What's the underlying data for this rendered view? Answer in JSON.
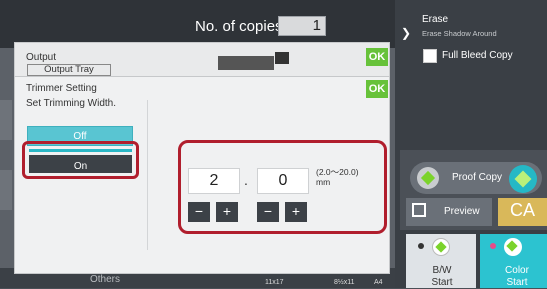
{
  "topbar": {
    "copies_label": "No. of copies",
    "copies_value": "1"
  },
  "right_panel": {
    "erase_title": "Erase",
    "erase_sub": "Erase Shadow Around",
    "full_bleed_label": "Full Bleed Copy",
    "proof_copy_label": "Proof Copy",
    "preview_label": "Preview",
    "ca_label": "CA",
    "bw_label": "B/W\nStart",
    "color_label": "Color\nStart"
  },
  "output_dialog": {
    "title": "Output",
    "tray": "Output Tray",
    "ok": "OK"
  },
  "trimmer_dialog": {
    "title": "Trimmer Setting",
    "subtitle": "Set Trimming Width.",
    "ok": "OK",
    "off_label": "Off",
    "on_label": "On",
    "integer_value": "2",
    "decimal_value": "0",
    "decimal_point": ".",
    "range": "(2.0～20.0)\nmm",
    "minus": "−",
    "plus": "+"
  },
  "bottom": {
    "others": "Others",
    "size_a": "11x17",
    "size_b": "8½x11",
    "size_c": "A4"
  },
  "colors": {
    "ok_green": "#67c23a",
    "highlight_red": "#b01e2d",
    "accent_cyan": "#2cc3d0"
  }
}
